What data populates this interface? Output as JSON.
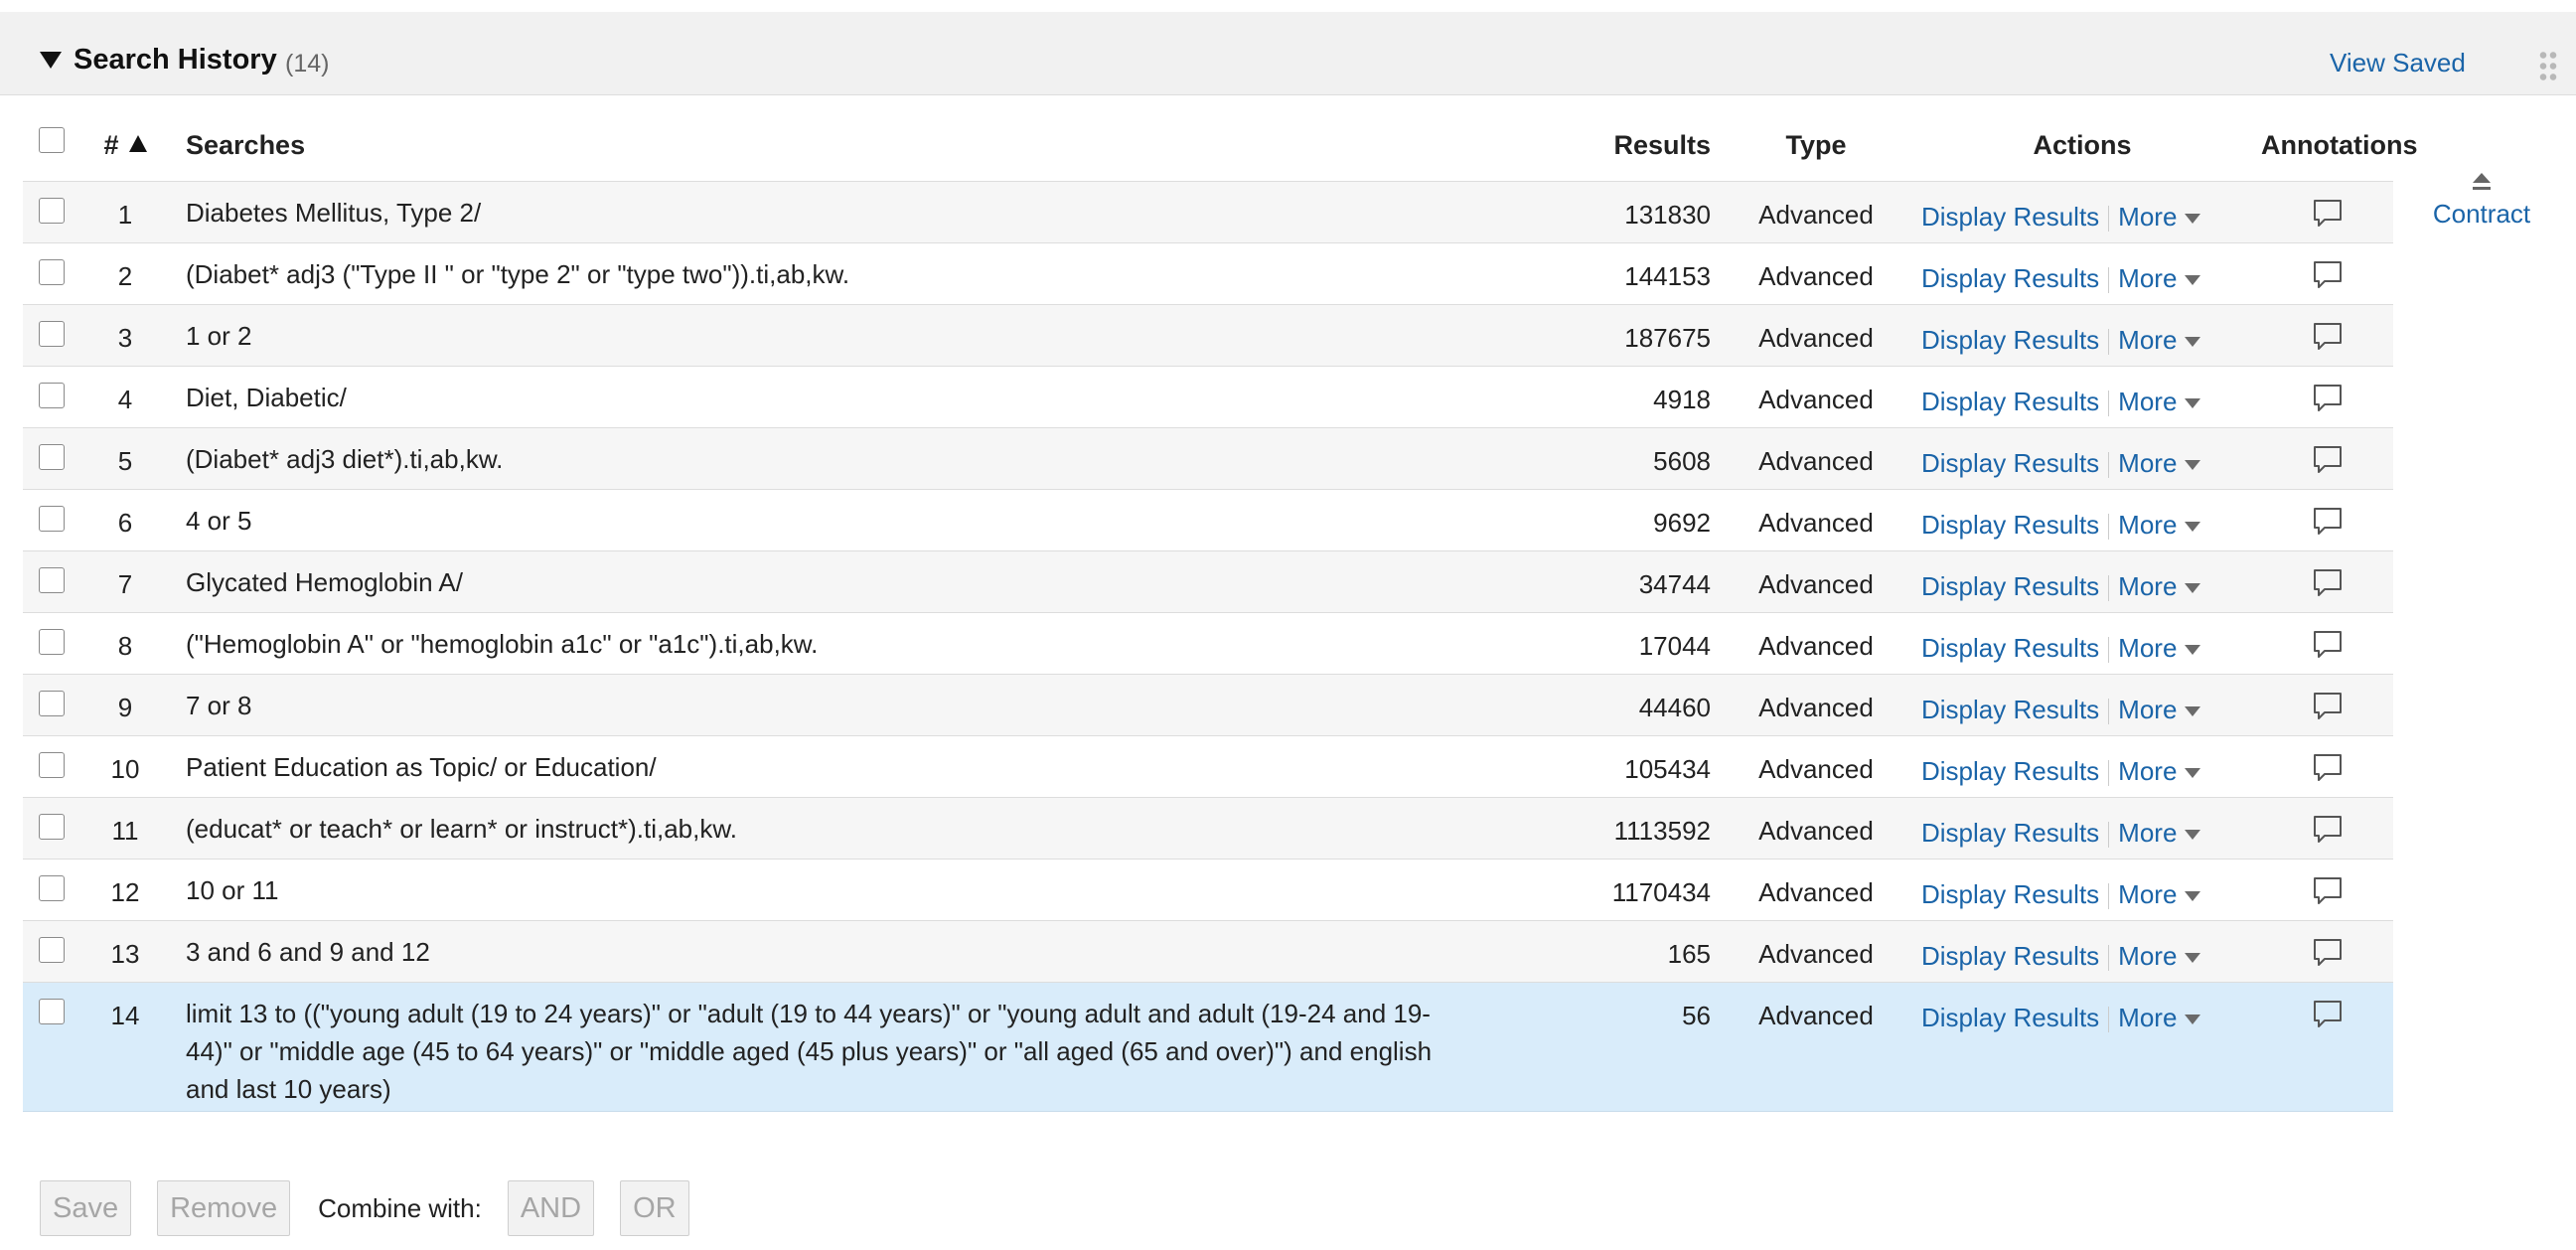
{
  "header": {
    "title": "Search History",
    "count": "(14)",
    "view_saved": "View Saved"
  },
  "table": {
    "columns": {
      "num": "#",
      "searches": "Searches",
      "results": "Results",
      "type": "Type",
      "actions": "Actions",
      "annotations": "Annotations"
    },
    "action_display": "Display Results",
    "action_more": "More",
    "rows": [
      {
        "num": "1",
        "search": "Diabetes Mellitus, Type 2/",
        "results": "131830",
        "type": "Advanced"
      },
      {
        "num": "2",
        "search": "(Diabet* adj3 (\"Type II \" or \"type 2\" or \"type two\")).ti,ab,kw.",
        "results": "144153",
        "type": "Advanced"
      },
      {
        "num": "3",
        "search": "1 or 2",
        "results": "187675",
        "type": "Advanced"
      },
      {
        "num": "4",
        "search": "Diet, Diabetic/",
        "results": "4918",
        "type": "Advanced"
      },
      {
        "num": "5",
        "search": "(Diabet* adj3 diet*).ti,ab,kw.",
        "results": "5608",
        "type": "Advanced"
      },
      {
        "num": "6",
        "search": "4 or 5",
        "results": "9692",
        "type": "Advanced"
      },
      {
        "num": "7",
        "search": "Glycated Hemoglobin A/",
        "results": "34744",
        "type": "Advanced"
      },
      {
        "num": "8",
        "search": "(\"Hemoglobin A\" or \"hemoglobin a1c\" or \"a1c\").ti,ab,kw.",
        "results": "17044",
        "type": "Advanced"
      },
      {
        "num": "9",
        "search": "7 or 8",
        "results": "44460",
        "type": "Advanced"
      },
      {
        "num": "10",
        "search": "Patient Education as Topic/ or Education/",
        "results": "105434",
        "type": "Advanced"
      },
      {
        "num": "11",
        "search": "(educat* or teach* or learn* or instruct*).ti,ab,kw.",
        "results": "1113592",
        "type": "Advanced"
      },
      {
        "num": "12",
        "search": "10 or 11",
        "results": "1170434",
        "type": "Advanced"
      },
      {
        "num": "13",
        "search": "3 and 6 and 9 and 12",
        "results": "165",
        "type": "Advanced"
      },
      {
        "num": "14",
        "search": "limit 13 to ((\"young adult (19 to 24 years)\" or \"adult (19 to 44 years)\" or \"young adult and adult (19-24 and 19-44)\" or \"middle age (45 to 64 years)\" or \"middle aged (45 plus years)\" or \"all aged (65 and over)\") and english and last 10 years)",
        "results": "56",
        "type": "Advanced"
      }
    ]
  },
  "sidebar": {
    "contract": "Contract"
  },
  "footer": {
    "save": "Save",
    "remove": "Remove",
    "combine_label": "Combine with:",
    "and": "AND",
    "or": "OR"
  },
  "colors": {
    "link": "#1a64a8",
    "selected_row": "#d9ecfa",
    "header_bg": "#f1f1f1"
  }
}
